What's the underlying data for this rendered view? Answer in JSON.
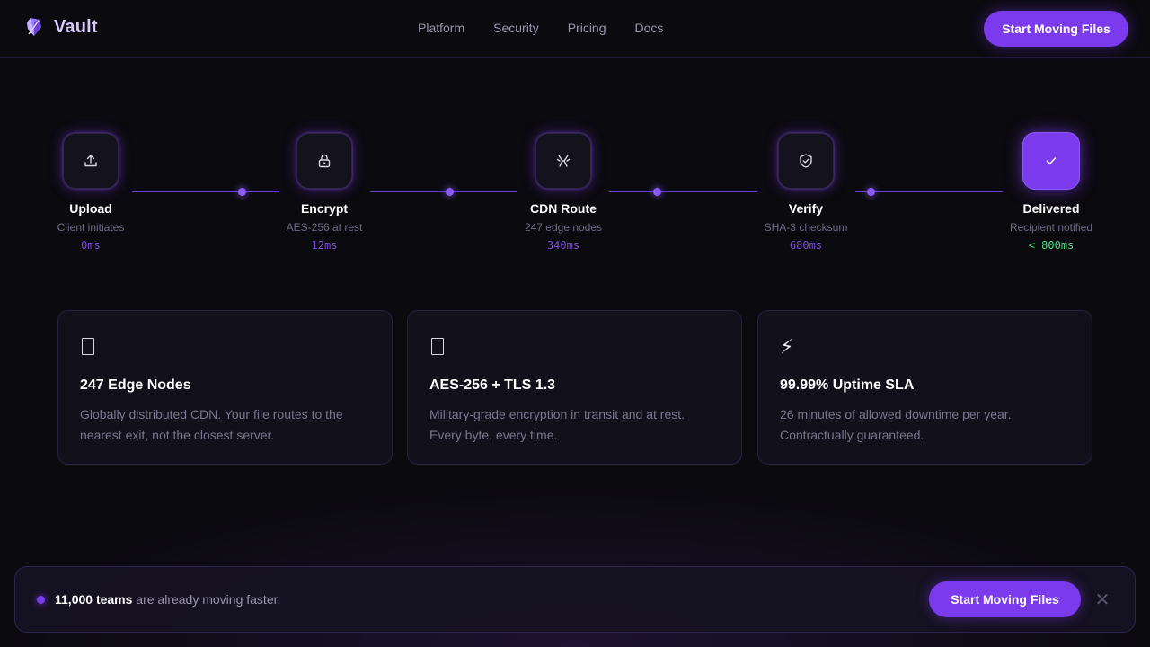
{
  "brand": {
    "name": "Vault",
    "icon": "vault-gem-icon",
    "accent": "#7c3aed"
  },
  "nav": {
    "links": [
      "Platform",
      "Security",
      "Pricing",
      "Docs"
    ],
    "cta": "Start Moving Files"
  },
  "pipeline": {
    "steps": [
      {
        "title": "Upload",
        "subtitle": "Client initiates",
        "time": "0ms",
        "icon": "upload-icon"
      },
      {
        "title": "Encrypt",
        "subtitle": "AES-256 at rest",
        "time": "12ms",
        "icon": "lock-icon"
      },
      {
        "title": "CDN Route",
        "subtitle": "247 edge nodes",
        "time": "340ms",
        "icon": "route-icon"
      },
      {
        "title": "Verify",
        "subtitle": "SHA-3 checksum",
        "time": "680ms",
        "icon": "shield-check-icon"
      },
      {
        "title": "Delivered",
        "subtitle": "Recipient notified",
        "time": "< 800ms",
        "icon": "check-icon"
      }
    ]
  },
  "features": [
    {
      "icon": "empty-box-icon",
      "title": "247 Edge Nodes",
      "body": "Globally distributed CDN. Your file routes to the nearest exit, not the closest server."
    },
    {
      "icon": "empty-box-icon",
      "title": "AES-256 + TLS 1.3",
      "body": "Military-grade encryption in transit and at rest. Every byte, every time."
    },
    {
      "icon": "lightning-icon",
      "glyph": "⚡",
      "title": "99.99% Uptime SLA",
      "body": "26 minutes of allowed downtime per year. Contractually guaranteed."
    }
  ],
  "banner": {
    "highlight": "11,000 teams",
    "text": " are already moving faster.",
    "cta": "Start Moving Files",
    "close": "✕"
  }
}
